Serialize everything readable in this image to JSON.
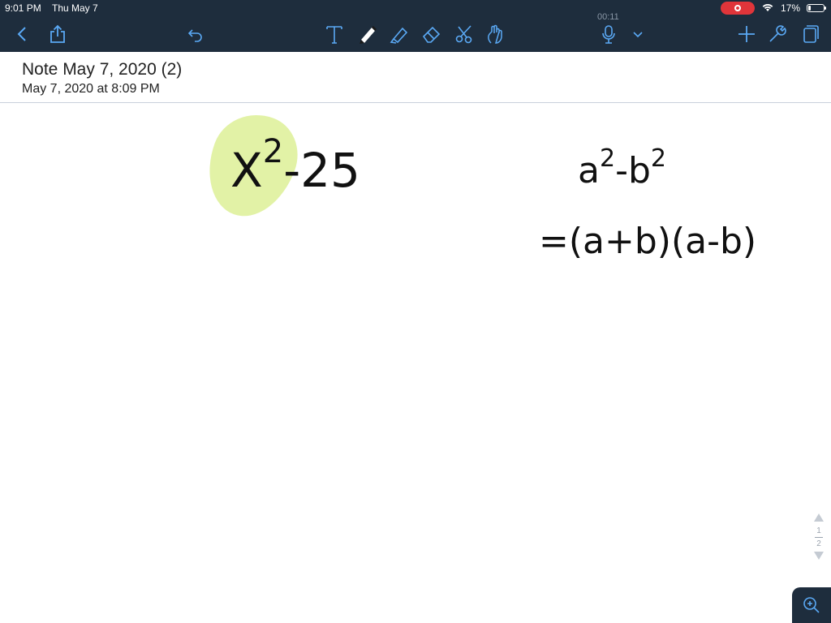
{
  "status": {
    "time": "9:01 PM",
    "date": "Thu May 7",
    "battery": "17%",
    "battery_level": 0.17
  },
  "recording": {
    "timer": "00:11"
  },
  "toolbar": {
    "icons": [
      "back-chevron-icon",
      "share-icon",
      "undo-icon",
      "text-tool-icon",
      "pen-tool-icon",
      "highlighter-tool-icon",
      "eraser-tool-icon",
      "scissors-tool-icon",
      "hand-tool-icon",
      "microphone-icon",
      "chevron-down-icon",
      "add-icon",
      "wrench-icon",
      "pages-icon"
    ],
    "accent": "#5aa9f5",
    "bg": "#1e2d3d"
  },
  "note": {
    "title": "Note May 7, 2020 (2)",
    "date": "May 7, 2020 at 8:09 PM"
  },
  "ink": {
    "expr1_base": "X",
    "expr1_exp": "2",
    "expr1_rest": "-25",
    "expr2_a": "a",
    "expr2_exp1": "2",
    "expr2_mid": "-b",
    "expr2_exp2": "2",
    "expr3": "=(a+b)(a-b)",
    "highlight_color": "#e2f2a6"
  },
  "pages": {
    "current": "1",
    "total": "2"
  }
}
